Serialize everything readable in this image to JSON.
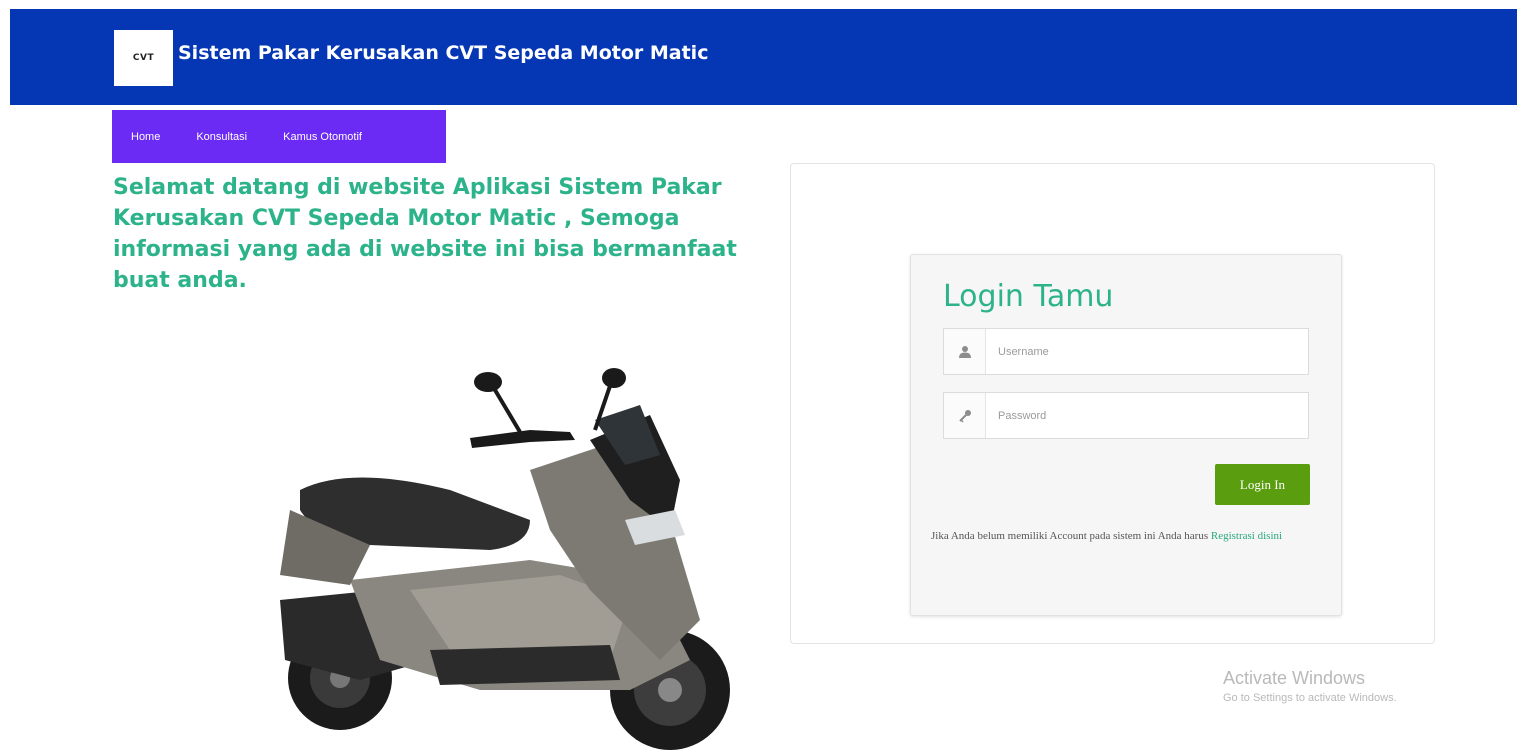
{
  "header": {
    "logo_text": "CVT",
    "title": "Sistem Pakar Kerusakan CVT Sepeda Motor Matic",
    "background_color": "#0536b3"
  },
  "nav": {
    "background_color": "#6c2bf5",
    "items": [
      {
        "label": "Home"
      },
      {
        "label": "Konsultasi"
      },
      {
        "label": "Kamus Otomotif"
      }
    ]
  },
  "welcome": {
    "text": "Selamat datang di website Aplikasi Sistem Pakar Kerusakan CVT Sepeda Motor Matic , Semoga informasi yang ada di website ini bisa bermanfaat buat anda.",
    "color": "#2db38a"
  },
  "hero_image": {
    "icon": "scooter-image"
  },
  "login": {
    "title": "Login Tamu",
    "username_placeholder": "Username",
    "password_placeholder": "Password",
    "username_icon": "user-icon",
    "password_icon": "key-icon",
    "button_label": "Login In",
    "button_color": "#5a9e0f",
    "note_text": "Jika Anda belum memiliki Account pada sistem ini Anda harus ",
    "register_link": "Registrasi disini"
  },
  "watermark": {
    "title": "Activate Windows",
    "subtitle": "Go to Settings to activate Windows."
  }
}
